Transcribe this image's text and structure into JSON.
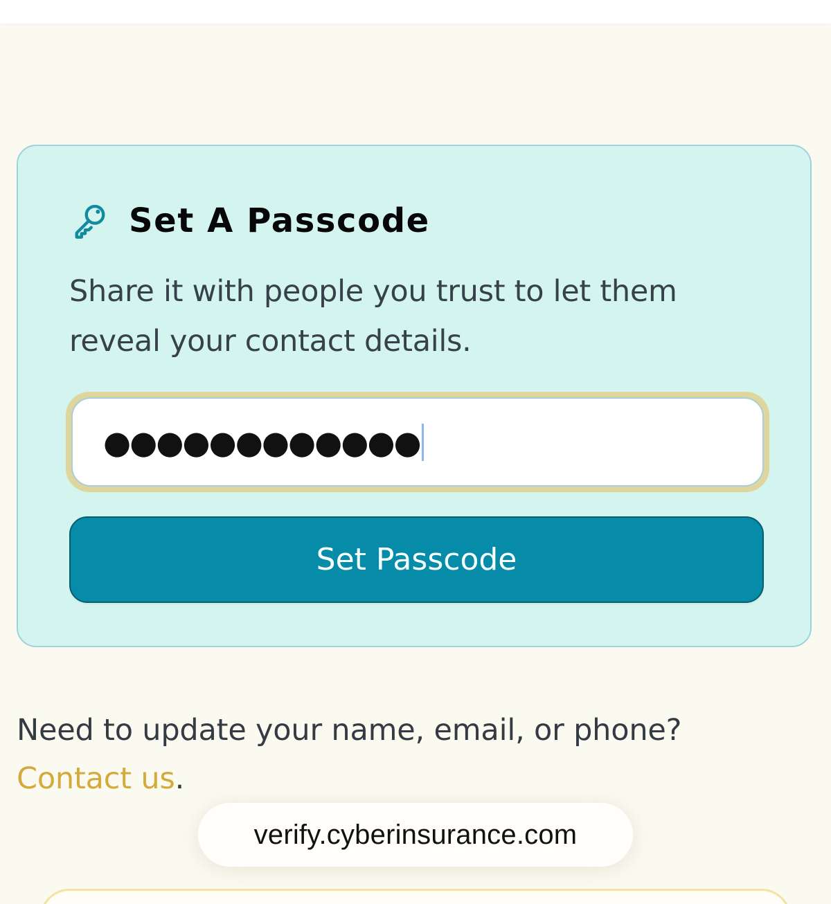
{
  "passcode_section": {
    "title": "Set A Passcode",
    "description": "Share it with people you trust to let them reveal your contact details.",
    "input_value": "●●●●●●●●●●●●",
    "button_label": "Set Passcode",
    "icon": "key-icon"
  },
  "footer": {
    "text": "Need to update your name, email, or phone?",
    "link_label": "Contact us",
    "punctuation": "."
  },
  "browser": {
    "url": "verify.cyberinsurance.com"
  },
  "colors": {
    "page_background": "#fbfaf1",
    "card_background": "#d4f5ef",
    "card_border": "#9fd2da",
    "input_focus_ring": "#dfd69d",
    "button_background": "#068ca9",
    "link_color": "#d4aa3a"
  }
}
